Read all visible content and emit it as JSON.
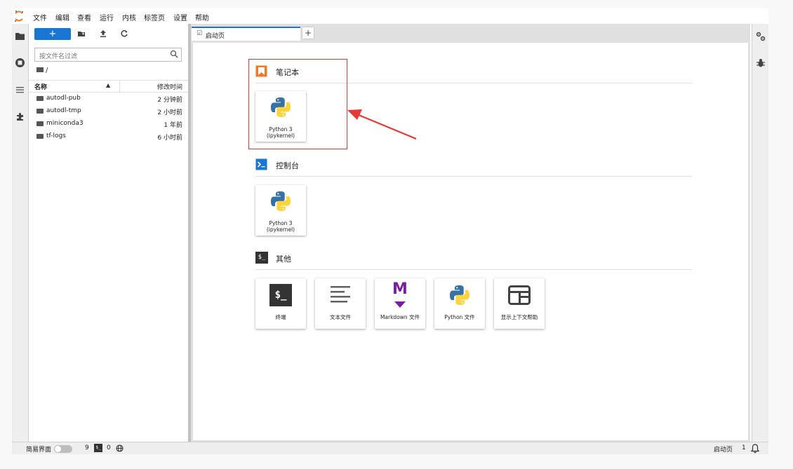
{
  "menubar": {
    "items": [
      "文件",
      "编辑",
      "查看",
      "运行",
      "内核",
      "标签页",
      "设置",
      "帮助"
    ]
  },
  "left_rail": {
    "icons": [
      "folder-icon",
      "running-icon",
      "toc-icon",
      "extension-icon"
    ]
  },
  "file_browser": {
    "new_label": "+",
    "filter_placeholder": "按文件名过滤",
    "breadcrumb": "/",
    "columns": {
      "name": "名称",
      "modified": "修改时间"
    },
    "rows": [
      {
        "name": "autodl-pub",
        "modified": "2 分钟前"
      },
      {
        "name": "autodl-tmp",
        "modified": "2 小时前"
      },
      {
        "name": "miniconda3",
        "modified": "1 年前"
      },
      {
        "name": "tf-logs",
        "modified": "6 小时前"
      }
    ]
  },
  "tabs": {
    "active_label": "启动页",
    "add_label": "+"
  },
  "launcher": {
    "notebook": {
      "title": "笔记本",
      "cards": [
        {
          "line1": "Python 3",
          "line2": "(ipykernel)"
        }
      ]
    },
    "console": {
      "title": "控制台",
      "icon_text": ">_",
      "cards": [
        {
          "line1": "Python 3",
          "line2": "(ipykernel)"
        }
      ]
    },
    "other": {
      "title": "其他",
      "icon_text": "$_",
      "cards": [
        {
          "label": "终端",
          "icon": "terminal-icon",
          "glyph": "$_"
        },
        {
          "label": "文本文件",
          "icon": "text-file-icon"
        },
        {
          "label": "Markdown 文件",
          "icon": "markdown-icon",
          "glyph": "M"
        },
        {
          "label": "Python 文件",
          "icon": "python-icon"
        },
        {
          "label": "显示上下文帮助",
          "icon": "context-help-icon"
        }
      ]
    }
  },
  "statusbar": {
    "simple_mode_label": "简易界面",
    "kernels_count": "9",
    "terminal_glyph": "$_",
    "terminals_count": "0",
    "right_label": "启动页",
    "right_count": "1"
  },
  "colors": {
    "accent": "#1976d2",
    "highlight": "#e53935",
    "notebook_icon": "#f37726"
  }
}
